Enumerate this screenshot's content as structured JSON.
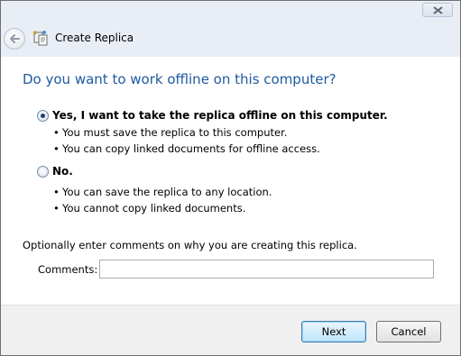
{
  "window": {
    "title": "Create Replica"
  },
  "heading": "Do you want to work offline on this computer?",
  "options": [
    {
      "label": "Yes, I want to take the replica offline on this computer.",
      "checked": true,
      "bullets": [
        "You must save the replica to this computer.",
        "You can copy linked documents for offline access."
      ]
    },
    {
      "label": "No.",
      "checked": false,
      "bullets": [
        "You can save the replica to any location.",
        "You cannot copy linked documents."
      ]
    }
  ],
  "comments": {
    "prompt": "Optionally enter comments on why you are creating this replica.",
    "label": "Comments:",
    "value": ""
  },
  "buttons": {
    "next": "Next",
    "cancel": "Cancel"
  },
  "colors": {
    "heading": "#1e5aa0",
    "chrome": "#e9eef6",
    "footer": "#f0f0f0"
  }
}
